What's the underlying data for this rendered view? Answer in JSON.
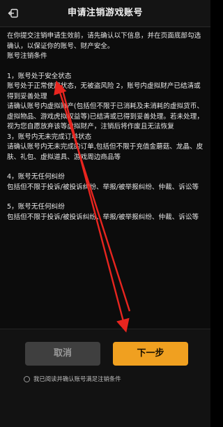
{
  "header": {
    "title": "申请注销游戏账号",
    "back_icon": "back-arrow-icon"
  },
  "content": {
    "intro": "在你提交注销申请生效前，请先确认以下信息，并在页面底部勾选确认，以保证你的账号、财产安全。",
    "conditions_heading": "账号注销条件",
    "sections": [
      {
        "heading": "1，账号处于安全状态",
        "body": "账号处于正常使用状态，无被盗风险 2，账号内虚拟财产已结清或得到妥善处理",
        "body2": "请确认账号内虚拟财产(包括但不限于已消耗及未消耗的虚拟货币、虚拟物品、游戏虎拟权益等)已结清或已得到妥善处理。若未处理，视为您自愿放弃该等虚拟财产，注销后将作废且无法恢复"
      },
      {
        "heading": "3，账号内无未完成订单状态",
        "body": "请确认账号内无未完成的订单,包括但不限于充值金蘑菇、龙晶、皮肤、礼包、虚拟道具、游戏周边商品等"
      },
      {
        "heading": "4，账号无任何纠纷",
        "body": "包括但不限于投诉/被投诉纠纷、举报/被举报纠纷、仲裁、诉讼等"
      },
      {
        "heading": "5，账号无任何纠纷",
        "body": "包括但不限于投诉/被投诉纠纷、举报/被举报纠纷、仲裁、诉讼等"
      }
    ]
  },
  "footer": {
    "cancel_label": "取消",
    "next_label": "下一步",
    "agree_label": "我已阅读并确认账号满足注销条件"
  },
  "colors": {
    "accent": "#f0a020",
    "annotation_red": "#e8251f"
  }
}
